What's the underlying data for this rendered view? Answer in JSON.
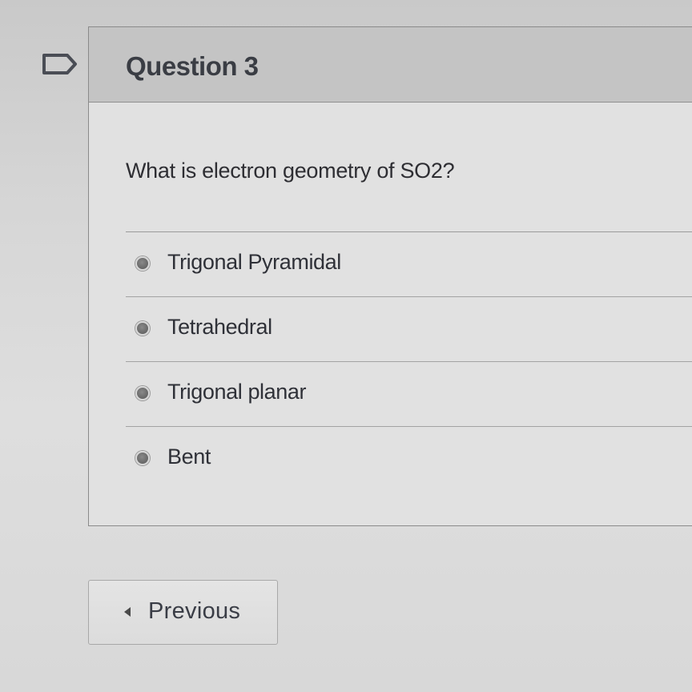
{
  "question": {
    "title": "Question 3",
    "text": "What is electron geometry of SO2?",
    "answers": [
      {
        "label": "Trigonal Pyramidal",
        "selected": false
      },
      {
        "label": "Tetrahedral",
        "selected": false
      },
      {
        "label": "Trigonal planar",
        "selected": false
      },
      {
        "label": "Bent",
        "selected": false
      }
    ]
  },
  "navigation": {
    "previous_label": "Previous"
  },
  "icons": {
    "flag": "flag-icon",
    "previous_arrow": "chevron-left-icon"
  },
  "colors": {
    "header_bg": "#c4c4c4",
    "card_bg": "#e1e1e1",
    "text": "#2f3138"
  }
}
